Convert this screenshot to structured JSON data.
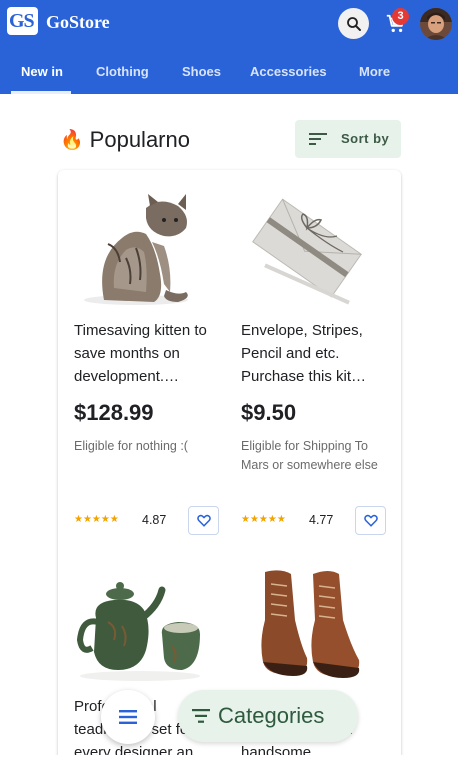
{
  "app": {
    "logo_text": "GS",
    "brand": "GoStore",
    "cart_count": "3"
  },
  "tabs": [
    {
      "label": "New in",
      "active": true
    },
    {
      "label": "Clothing",
      "active": false
    },
    {
      "label": "Shoes",
      "active": false
    },
    {
      "label": "Accessories",
      "active": false
    },
    {
      "label": "More",
      "active": false
    }
  ],
  "section": {
    "title": "Popularno",
    "emoji": "🔥",
    "sort_label": "Sort by"
  },
  "products": [
    {
      "image": "kitten-photo",
      "title": "Timesaving kitten to save months on development.…",
      "price": "$128.99",
      "shipping": "Eligible for nothing :(",
      "stars": "★★★★★",
      "rating_value": 4.87,
      "rating": "4.87"
    },
    {
      "image": "envelope-pencil-photo",
      "title": "Envelope, Stripes, Pencil and etc. Purchase this kit…",
      "price": "$9.50",
      "shipping": "Eligible for Shipping To Mars or somewhere else",
      "stars": "★★★★★",
      "rating_value": 4.77,
      "rating": "4.77"
    },
    {
      "image": "teapot-cup-photo",
      "title": "Professional teadrinking set for every designer an…",
      "price": "",
      "shipping": "",
      "stars": "",
      "rating": ""
    },
    {
      "image": "leather-boots-photo",
      "title": "Modern design. Leather boots for handsome…",
      "price": "",
      "shipping": "",
      "stars": "",
      "rating": ""
    }
  ],
  "bottom": {
    "categories_label": "Categories"
  },
  "colors": {
    "primary": "#2a63d8",
    "accent_green_bg": "#e6f2ea",
    "star": "#f4a300",
    "badge": "#e53935"
  }
}
